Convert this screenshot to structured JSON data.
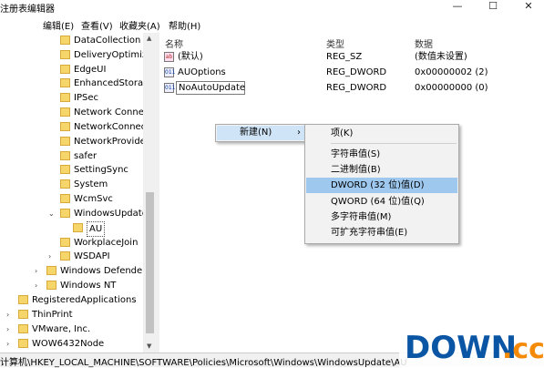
{
  "window": {
    "title": "注册表编辑器"
  },
  "window_controls": {
    "minimize": "—",
    "maximize": "☐",
    "close": "✕"
  },
  "menu": [
    "编辑(E)",
    "查看(V)",
    "收藏夹(A)",
    "帮助(H)"
  ],
  "tree": {
    "items": [
      {
        "label": "DataCollection"
      },
      {
        "label": "DeliveryOptimiza"
      },
      {
        "label": "EdgeUI"
      },
      {
        "label": "EnhancedStorag"
      },
      {
        "label": "IPSec"
      },
      {
        "label": "Network Connec"
      },
      {
        "label": "NetworkConnect"
      },
      {
        "label": "NetworkProvide"
      },
      {
        "label": "safer"
      },
      {
        "label": "SettingSync"
      },
      {
        "label": "System"
      },
      {
        "label": "WcmSvc"
      },
      {
        "label": "WindowsUpdate"
      },
      {
        "label": "AU"
      },
      {
        "label": "WorkplaceJoin"
      },
      {
        "label": "WSDAPI"
      },
      {
        "label": "Windows Defender"
      },
      {
        "label": "Windows NT"
      },
      {
        "label": "RegisteredApplications"
      },
      {
        "label": "ThinPrint"
      },
      {
        "label": "VMware, Inc."
      },
      {
        "label": "WOW6432Node"
      }
    ]
  },
  "list": {
    "columns": {
      "name": "名称",
      "type": "类型",
      "data": "数据"
    },
    "rows": [
      {
        "name": "(默认)",
        "type": "REG_SZ",
        "data": "(数值未设置)",
        "icon": "ab"
      },
      {
        "name": "AUOptions",
        "type": "REG_DWORD",
        "data": "0x00000002 (2)",
        "icon": "011"
      },
      {
        "name": "NoAutoUpdate",
        "type": "REG_DWORD",
        "data": "0x00000000 (0)",
        "icon": "011"
      }
    ]
  },
  "context_menu": {
    "new_label": "新建(N)",
    "arrow": "›",
    "submenu": [
      "项(K)",
      "字符串值(S)",
      "二进制值(B)",
      "DWORD (32 位)值(D)",
      "QWORD (64 位)值(Q)",
      "多字符串值(M)",
      "可扩充字符串值(E)"
    ]
  },
  "statusbar": {
    "path": "计算机\\HKEY_LOCAL_MACHINE\\SOFTWARE\\Policies\\Microsoft\\Windows\\WindowsUpdate\\AU"
  },
  "watermark": {
    "text": "DOWN.cc"
  },
  "colors": {
    "folder": "#f6d56a",
    "highlight": "#9ec8ee",
    "new_highlight": "#cfe4f7",
    "logo_blue": "#0b56a4",
    "logo_orange": "#f58a07"
  }
}
